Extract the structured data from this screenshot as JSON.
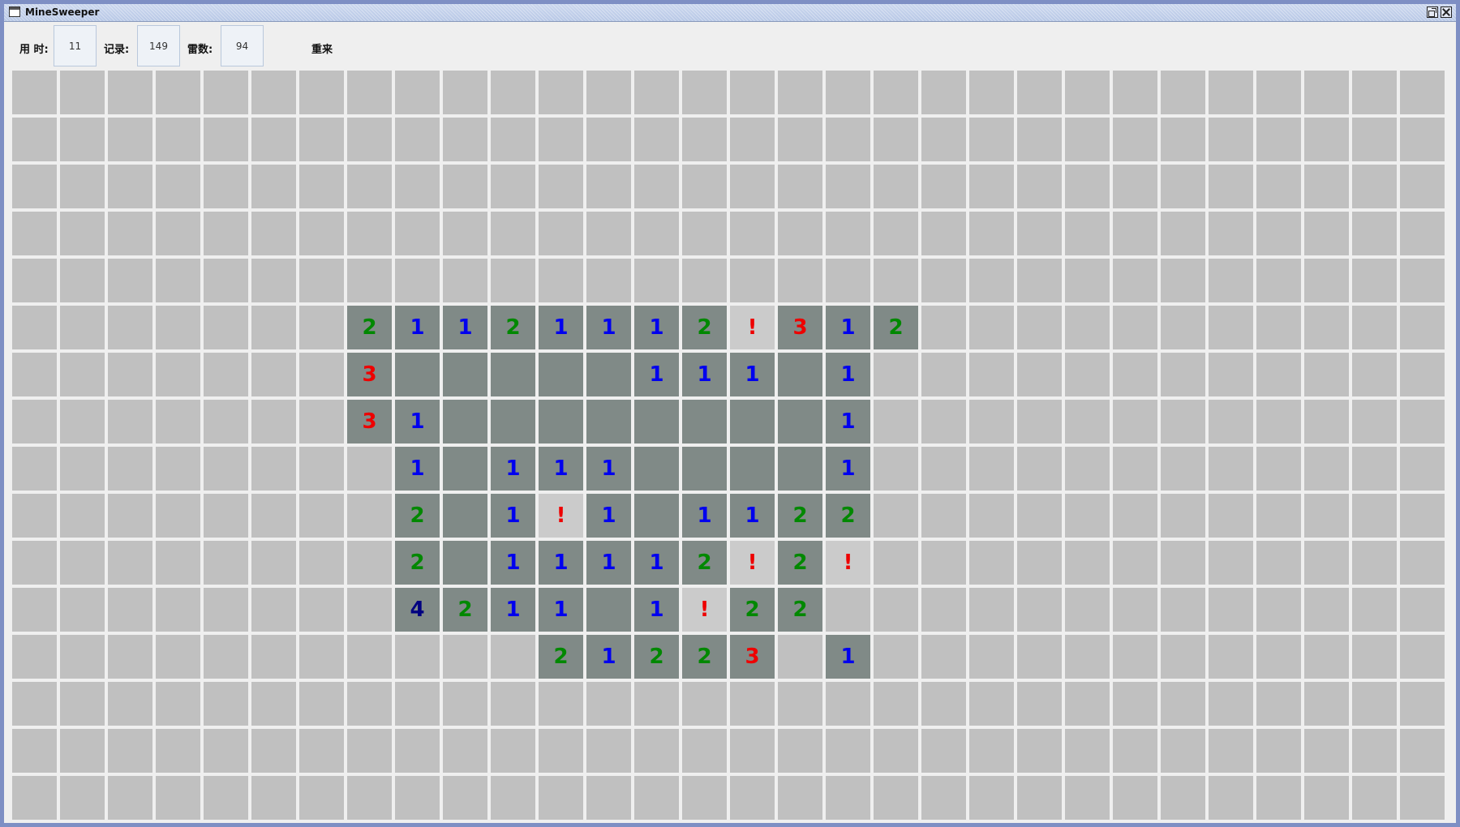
{
  "window": {
    "title": "MineSweeper"
  },
  "toolbar": {
    "time_label": "用 时:",
    "time_value": "11",
    "record_label": "记录:",
    "record_value": "149",
    "mines_label": "雷数:",
    "mines_value": "94",
    "restart_label": "重来"
  },
  "board": {
    "cols": 30,
    "rows": 16,
    "legend": {
      "#": "unopened",
      "_": "opened-empty",
      "!": "flagged",
      "1-8": "opened-number"
    },
    "rows_data": [
      "##############################",
      "##############################",
      "##############################",
      "##############################",
      "##############################",
      "#######21121112!312###########",
      "#######3_____111_1###########",
      "#######31________1###########",
      "########1_111____1###########",
      "########2_1!1_1122###########",
      "########2_11112!2!###########",
      "########4211_1!22############",
      "###########21223 1############"
    ],
    "colors": {
      "1": "#0000ee",
      "2": "#008800",
      "3": "#ee0000",
      "4": "#000080",
      "flag": "#ee0000",
      "open": "#808a87",
      "hidden": "#c0c0c0"
    }
  }
}
